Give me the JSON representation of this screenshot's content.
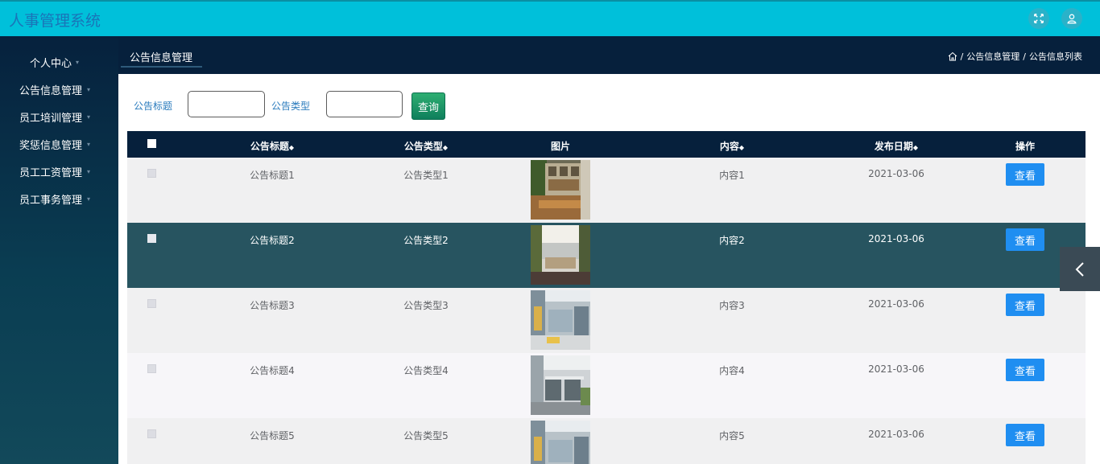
{
  "app": {
    "title": "人事管理系统"
  },
  "topbar": {
    "fullscreen_icon": "fullscreen-icon",
    "user_icon": "user-icon"
  },
  "sidebar": {
    "items": [
      {
        "label": "个人中心"
      },
      {
        "label": "公告信息管理"
      },
      {
        "label": "员工培训管理"
      },
      {
        "label": "奖惩信息管理"
      },
      {
        "label": "员工工资管理"
      },
      {
        "label": "员工事务管理"
      }
    ]
  },
  "header": {
    "tab_title": "公告信息管理",
    "breadcrumb": {
      "home_icon": "home-icon",
      "level1": "公告信息管理",
      "sep": "/",
      "level2": "公告信息列表"
    }
  },
  "search": {
    "title_label": "公告标题",
    "title_value": "",
    "type_label": "公告类型",
    "type_value": "",
    "button": "查询"
  },
  "table": {
    "columns": {
      "title": "公告标题",
      "type": "公告类型",
      "image": "图片",
      "content": "内容",
      "date": "发布日期",
      "action": "操作"
    },
    "rows": [
      {
        "title": "公告标题1",
        "type": "公告类型1",
        "content": "内容1",
        "date": "2021-03-06",
        "action": "查看"
      },
      {
        "title": "公告标题2",
        "type": "公告类型2",
        "content": "内容2",
        "date": "2021-03-06",
        "action": "查看"
      },
      {
        "title": "公告标题3",
        "type": "公告类型3",
        "content": "内容3",
        "date": "2021-03-06",
        "action": "查看"
      },
      {
        "title": "公告标题4",
        "type": "公告类型4",
        "content": "内容4",
        "date": "2021-03-06",
        "action": "查看"
      },
      {
        "title": "公告标题5",
        "type": "公告类型5",
        "content": "内容5",
        "date": "2021-03-06",
        "action": "查看"
      }
    ]
  },
  "colors": {
    "topbar": "#00c0da",
    "sidebar": "#06213d",
    "header": "#06203c",
    "selected_row": "#275460",
    "button": "#1f8ef1",
    "search_button": "#1a9a66"
  }
}
